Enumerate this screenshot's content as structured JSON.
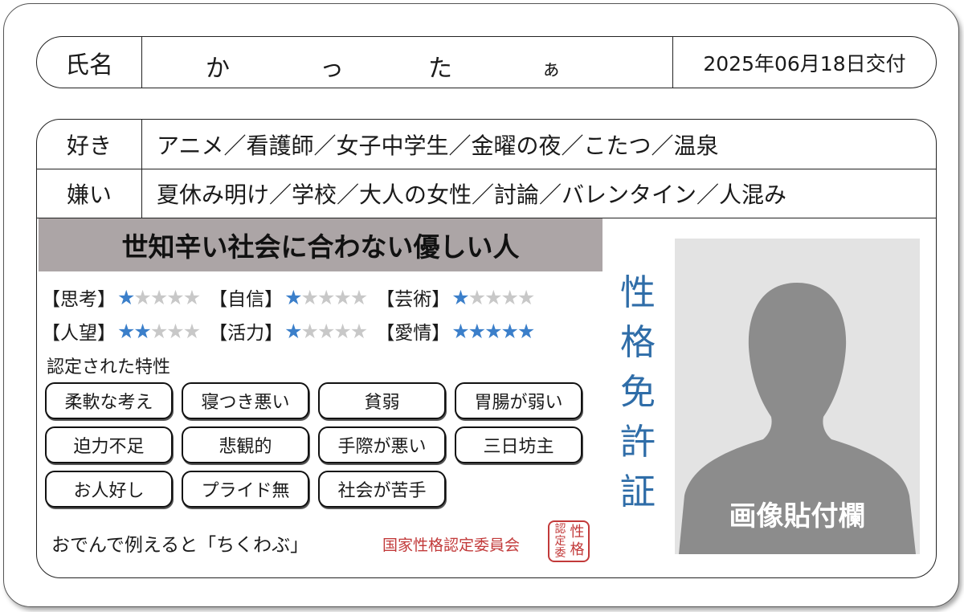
{
  "name": {
    "label": "氏名",
    "chars": [
      "か",
      "っ",
      "た",
      "ぁ"
    ],
    "issued": "2025年06月18日交付"
  },
  "likes": {
    "label": "好き",
    "value": "アニメ／看護師／女子中学生／金曜の夜／こたつ／温泉"
  },
  "dislikes": {
    "label": "嫌い",
    "value": "夏休み明け／学校／大人の女性／討論／バレンタイン／人混み"
  },
  "title": "世知辛い社会に合わない優しい人",
  "stats": [
    {
      "label": "【思考】",
      "value": 1,
      "max": 5
    },
    {
      "label": "【自信】",
      "value": 1,
      "max": 5
    },
    {
      "label": "【芸術】",
      "value": 1,
      "max": 5
    },
    {
      "label": "【人望】",
      "value": 2,
      "max": 5
    },
    {
      "label": "【活力】",
      "value": 1,
      "max": 5
    },
    {
      "label": "【愛情】",
      "value": 5,
      "max": 5
    }
  ],
  "traits_title": "認定された特性",
  "traits": [
    "柔軟な考え",
    "寝つき悪い",
    "貧弱",
    "胃腸が弱い",
    "迫力不足",
    "悲観的",
    "手際が悪い",
    "三日坊主",
    "お人好し",
    "プライド無",
    "社会が苦手"
  ],
  "analogy": "おでんで例えると「ちくわぶ」",
  "committee": "国家性格認定委員会",
  "seal": [
    "認",
    "定",
    "委",
    "性",
    "格"
  ],
  "vertical_title": [
    "性",
    "格",
    "免",
    "許",
    "証"
  ],
  "photo_caption": "画像貼付欄",
  "colors": {
    "star_on": "#3b7fca",
    "star_off": "#c8c8c8",
    "title_band": "#aca5a6",
    "vertical_title": "#2f6da8",
    "committee": "#c23a3a",
    "silhouette": "#8c8c8c"
  }
}
